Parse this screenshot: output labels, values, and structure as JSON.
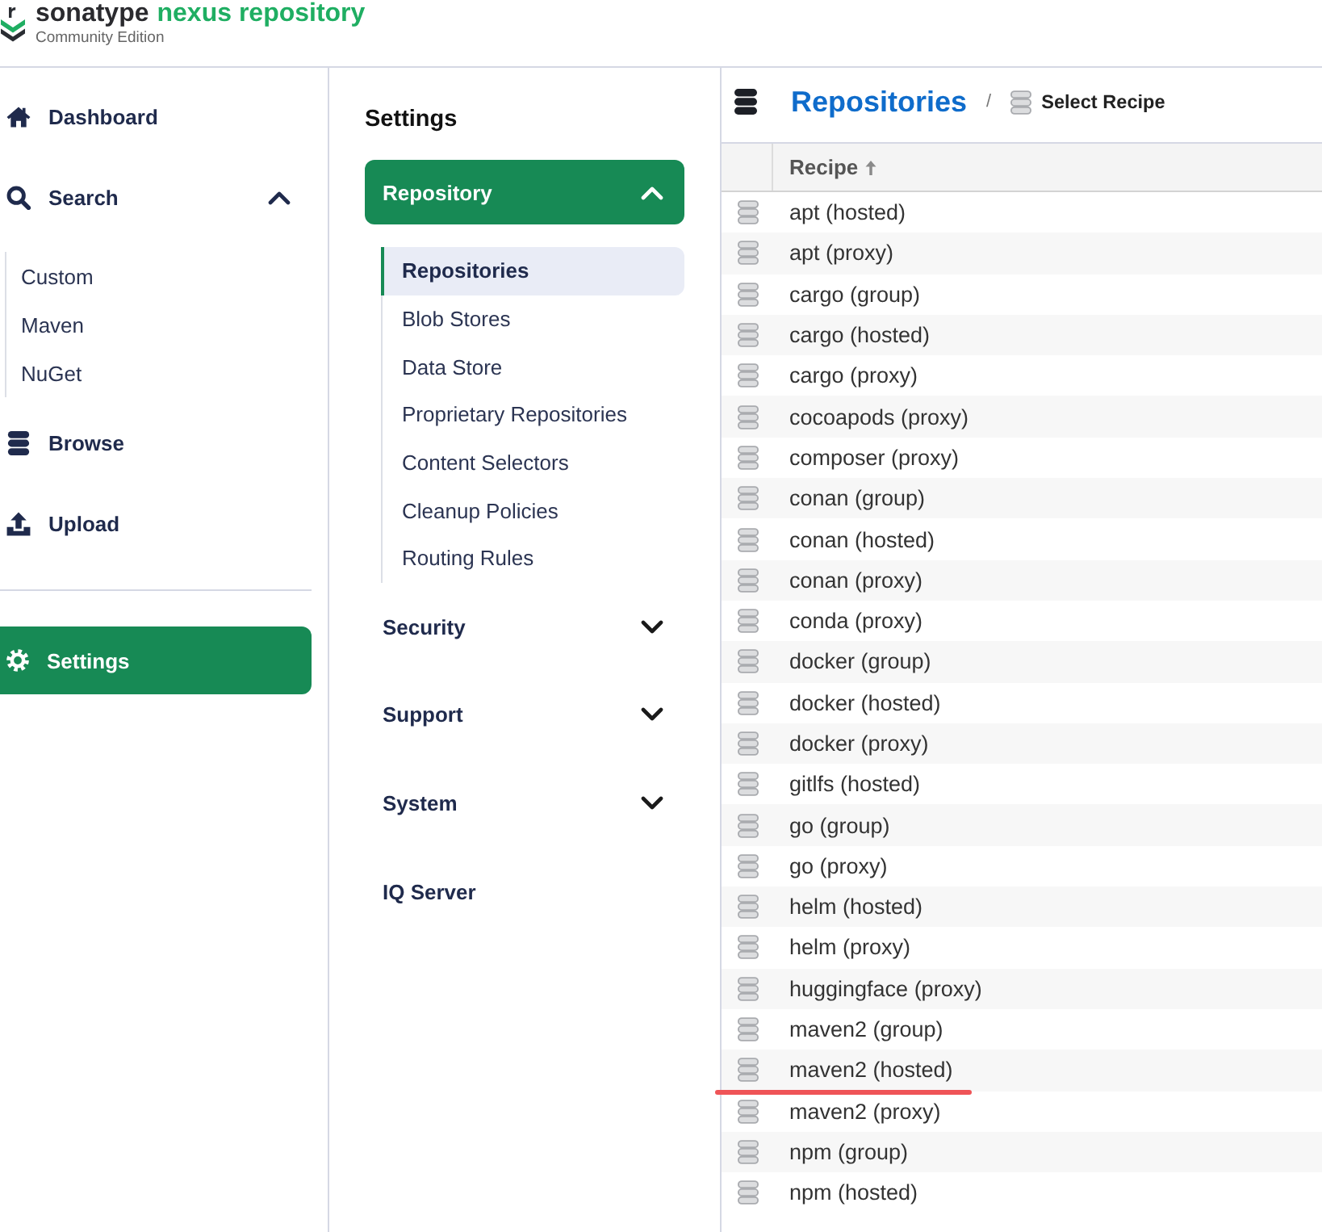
{
  "brand": {
    "name": "sonatype",
    "product": "nexus repository",
    "edition": "Community Edition"
  },
  "sidebar": {
    "main_items": [
      {
        "label": "Dashboard",
        "kind": "link",
        "selected": false
      },
      {
        "label": "Search",
        "kind": "group",
        "selected": false,
        "expanded": true,
        "children": [
          {
            "label": "Custom",
            "selected": false
          },
          {
            "label": "Maven",
            "selected": false
          },
          {
            "label": "NuGet",
            "selected": false
          }
        ]
      },
      {
        "label": "Browse",
        "kind": "link",
        "selected": false
      },
      {
        "label": "Upload",
        "kind": "link",
        "selected": false
      }
    ],
    "admin_items": [
      {
        "label": "Settings",
        "selected": true
      }
    ]
  },
  "settings_nav": {
    "title": "Settings",
    "groups": [
      {
        "label": "Repository",
        "kind": "group",
        "selected": true,
        "expanded": true,
        "children": [
          {
            "label": "Repositories",
            "selected": true
          },
          {
            "label": "Blob Stores",
            "selected": false
          },
          {
            "label": "Data Store",
            "selected": false
          },
          {
            "label": "Proprietary Repositories",
            "selected": false
          },
          {
            "label": "Content Selectors",
            "selected": false
          },
          {
            "label": "Cleanup Policies",
            "selected": false
          },
          {
            "label": "Routing Rules",
            "selected": false
          }
        ]
      },
      {
        "label": "Security",
        "kind": "group",
        "selected": false,
        "expanded": false
      },
      {
        "label": "Support",
        "kind": "group",
        "selected": false,
        "expanded": false
      },
      {
        "label": "System",
        "kind": "group",
        "selected": false,
        "expanded": false
      },
      {
        "label": "IQ Server",
        "kind": "link",
        "selected": false
      }
    ]
  },
  "content": {
    "breadcrumb": {
      "title": "Repositories",
      "separator": "/",
      "current": "Select Recipe"
    },
    "table": {
      "columns": [
        {
          "label": "Recipe",
          "sorted": true
        }
      ],
      "rows": [
        {
          "recipe": "apt (hosted)",
          "underlined": false
        },
        {
          "recipe": "apt (proxy)",
          "underlined": false
        },
        {
          "recipe": "cargo (group)",
          "underlined": false
        },
        {
          "recipe": "cargo (hosted)",
          "underlined": false
        },
        {
          "recipe": "cargo (proxy)",
          "underlined": false
        },
        {
          "recipe": "cocoapods (proxy)",
          "underlined": false
        },
        {
          "recipe": "composer (proxy)",
          "underlined": false
        },
        {
          "recipe": "conan (group)",
          "underlined": false
        },
        {
          "recipe": "conan (hosted)",
          "underlined": false
        },
        {
          "recipe": "conan (proxy)",
          "underlined": false
        },
        {
          "recipe": "conda (proxy)",
          "underlined": false
        },
        {
          "recipe": "docker (group)",
          "underlined": false
        },
        {
          "recipe": "docker (hosted)",
          "underlined": false
        },
        {
          "recipe": "docker (proxy)",
          "underlined": false
        },
        {
          "recipe": "gitlfs (hosted)",
          "underlined": false
        },
        {
          "recipe": "go (group)",
          "underlined": false
        },
        {
          "recipe": "go (proxy)",
          "underlined": false
        },
        {
          "recipe": "helm (hosted)",
          "underlined": false
        },
        {
          "recipe": "helm (proxy)",
          "underlined": false
        },
        {
          "recipe": "huggingface (proxy)",
          "underlined": false
        },
        {
          "recipe": "maven2 (group)",
          "underlined": false
        },
        {
          "recipe": "maven2 (hosted)",
          "underlined": true
        },
        {
          "recipe": "maven2 (proxy)",
          "underlined": false
        },
        {
          "recipe": "npm (group)",
          "underlined": false
        },
        {
          "recipe": "npm (hosted)",
          "underlined": false
        }
      ]
    }
  }
}
